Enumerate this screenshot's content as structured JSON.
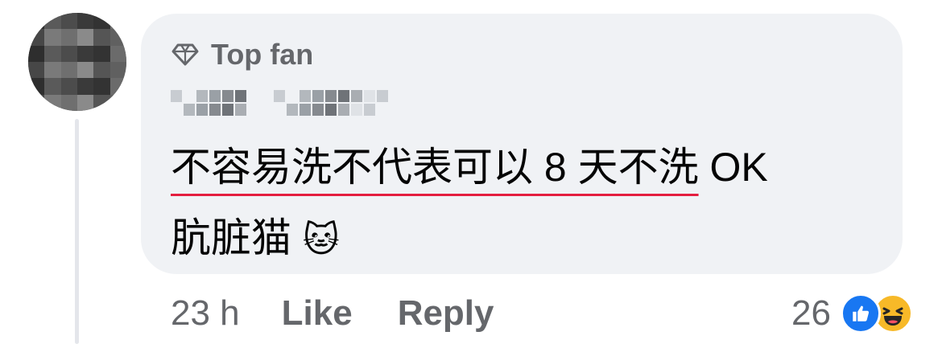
{
  "comment": {
    "badge_label": "Top fan",
    "badge_icon": "diamond-icon",
    "text_underlined": "不容易洗不代表可以 8 天不洗",
    "text_line1_rest": " OK",
    "text_line2": "肮脏猫",
    "emoji": "🐱",
    "underline_color": "#e41e3f"
  },
  "actions": {
    "time": "23 h",
    "like_label": "Like",
    "reply_label": "Reply"
  },
  "reactions": {
    "count": "26",
    "icons": [
      "like-reaction-icon",
      "haha-reaction-icon"
    ],
    "like_color": "#1877f2",
    "haha_color": "#f7b928"
  }
}
